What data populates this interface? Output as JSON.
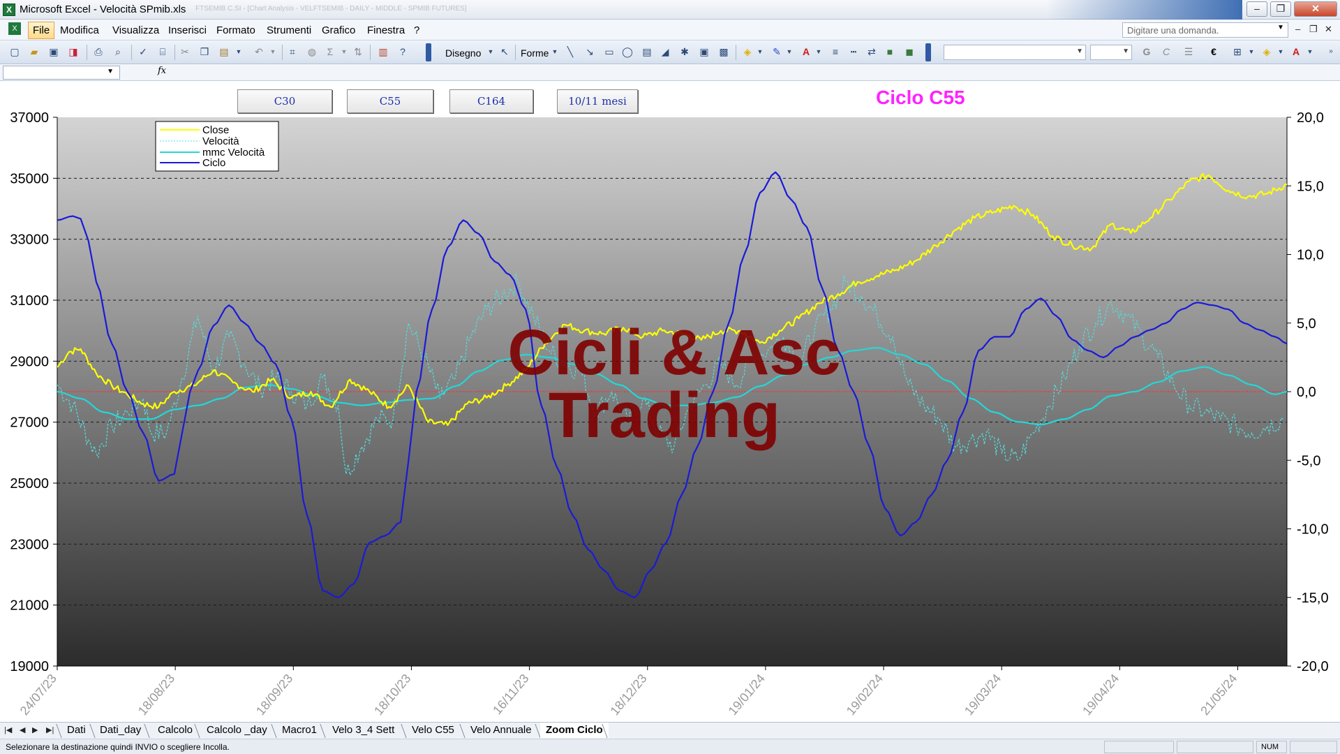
{
  "window": {
    "title": "Microsoft Excel - Velocità SPmib.xls",
    "title_blur": "FTSEMIB C.SI - [Chart Analysis - VELFTSEMIB - DAILY - MIDDLE - SPMIB FUTURES]",
    "btn_minimize": "–",
    "btn_restore": "❐",
    "btn_close": "✕"
  },
  "menu": {
    "items": [
      "File",
      "Modifica",
      "Visualizza",
      "Inserisci",
      "Formato",
      "Strumenti",
      "Grafico",
      "Finestra",
      "?"
    ],
    "ask_placeholder": "Digitare una domanda.",
    "mdi_minimize": "–",
    "mdi_restore": "❐",
    "mdi_close": "✕"
  },
  "toolbar": {
    "disegno_label": "Disegno",
    "forme_label": "Forme",
    "bold_label": "G",
    "italic_label": "C",
    "euro_label": "€",
    "sigma_label": "Σ",
    "font_letter": "A"
  },
  "formula_bar": {
    "fx": "fx"
  },
  "chart_buttons": [
    "C30",
    "C55",
    "C164",
    "10/11 mesi"
  ],
  "chart_heading": "Ciclo C55",
  "watermark": [
    "Cicli & Asc",
    "Trading"
  ],
  "sheet_tabs": [
    "Dati",
    "Dati_day",
    "Calcolo",
    "Calcolo _day",
    "Macro1",
    "Velo 3_4 Sett",
    "Velo C55",
    "Velo Annuale",
    "Zoom Ciclo"
  ],
  "active_tab": "Zoom Ciclo",
  "status": {
    "message": "Selezionare la destinazione quindi INVIO o scegliere Incolla.",
    "num": "NUM"
  },
  "chart_data": {
    "type": "line",
    "legend": [
      "Close",
      "Velocità",
      "mmc Velocità",
      "Ciclo"
    ],
    "legend_placement": "top-left",
    "colors": {
      "close": "#ffff00",
      "velocita": "#55dddd",
      "mmc_velocita": "#22d8d8",
      "ciclo": "#1a1ad8",
      "zero_line": "#ff3030",
      "heading": "#ff22ff",
      "watermark": "#800000"
    },
    "x_ticks": [
      "24/07/23",
      "18/08/23",
      "18/09/23",
      "18/10/23",
      "16/11/23",
      "18/12/23",
      "19/01/24",
      "19/02/24",
      "19/03/24",
      "19/04/24",
      "21/05/24"
    ],
    "y_left": {
      "range": [
        19000,
        37000
      ],
      "ticks": [
        "37000",
        "35000",
        "33000",
        "31000",
        "29000",
        "27000",
        "25000",
        "23000",
        "21000",
        "19000"
      ]
    },
    "y_right": {
      "range": [
        -20,
        20
      ],
      "ticks": [
        "20,0",
        "15,0",
        "10,0",
        "5,0",
        "0,0",
        "-5,0",
        "-10,0",
        "-15,0",
        "-20,0"
      ]
    },
    "grid": "horizontal dashed",
    "background": "vertical gradient light gray to dark gray",
    "series": [
      {
        "name": "Close",
        "axis": "left",
        "x": [
          0,
          3,
          6,
          10,
          14,
          18,
          22,
          26,
          30,
          35,
          40,
          45,
          50,
          55,
          60,
          65,
          70,
          75,
          80,
          85,
          90,
          95,
          100,
          105,
          110,
          115,
          120,
          125,
          130,
          135,
          140,
          145,
          150,
          155,
          160,
          165,
          170,
          175,
          180,
          185,
          190,
          195,
          200,
          205,
          210,
          215,
          220,
          225,
          230,
          235,
          240,
          245,
          250,
          255,
          260,
          265,
          270,
          275,
          280,
          285,
          290,
          295,
          300,
          305,
          310,
          315
        ],
        "y": [
          28800,
          29300,
          29400,
          28600,
          28200,
          27900,
          27600,
          27500,
          28000,
          28200,
          28700,
          28300,
          28000,
          28400,
          27800,
          28000,
          27500,
          28400,
          28000,
          27500,
          28200,
          27000,
          26900,
          27600,
          27800,
          28200,
          28700,
          29600,
          30200,
          30000,
          29900,
          30100,
          29800,
          30000,
          29900,
          29700,
          30000,
          30000,
          29600,
          30000,
          30400,
          30900,
          31200,
          31600,
          31800,
          32000,
          32300,
          32800,
          33300,
          33700,
          33900,
          34100,
          33800,
          33100,
          32800,
          32700,
          33500,
          33200,
          33700,
          34300,
          34900,
          35100,
          34600,
          34400,
          34500,
          34800
        ]
      },
      {
        "name": "Velocità",
        "axis": "right",
        "x": [
          0,
          4,
          8,
          10,
          14,
          18,
          22,
          24,
          28,
          32,
          36,
          40,
          44,
          48,
          52,
          56,
          60,
          64,
          68,
          72,
          74,
          78,
          82,
          86,
          90,
          94,
          98,
          102,
          106,
          110,
          114,
          118,
          122,
          126,
          130,
          134,
          138,
          142,
          146,
          150,
          154,
          158,
          162,
          166,
          170,
          174,
          178,
          182,
          186,
          190,
          194,
          198,
          202,
          206,
          210,
          214,
          218,
          222,
          226,
          230,
          234,
          238,
          242,
          246,
          250,
          254,
          258,
          262,
          266,
          270,
          274,
          278,
          282,
          286,
          290,
          294,
          298,
          302,
          306,
          310,
          314
        ],
        "y": [
          0.5,
          -1.0,
          -3.5,
          -4.5,
          -2.5,
          -1.5,
          -0.5,
          -3.0,
          -3.0,
          1.0,
          5.5,
          1.5,
          4.0,
          2.0,
          0.2,
          1.0,
          0.0,
          -1.0,
          1.0,
          -1.0,
          -6.0,
          -4.0,
          -2.0,
          -2.0,
          5.0,
          2.5,
          -0.5,
          1.0,
          4.0,
          6.0,
          7.0,
          8.0,
          5.5,
          3.0,
          2.0,
          1.5,
          -1.5,
          0.0,
          -2.0,
          -0.5,
          -3.0,
          -4.0,
          -1.0,
          0.5,
          2.0,
          0.5,
          2.5,
          3.0,
          4.0,
          2.0,
          4.5,
          6.0,
          8.0,
          7.0,
          5.5,
          4.0,
          0.5,
          -1.0,
          -2.0,
          -4.0,
          -3.5,
          -3.0,
          -4.5,
          -5.0,
          -3.0,
          -1.0,
          1.0,
          3.5,
          5.0,
          6.5,
          5.5,
          4.0,
          2.5,
          0.5,
          -1.0,
          -1.5,
          -2.0,
          -2.5,
          -3.0,
          -2.5,
          -2.0
        ]
      },
      {
        "name": "mmc Velocità",
        "axis": "right",
        "x": [
          0,
          6,
          12,
          18,
          24,
          30,
          36,
          42,
          48,
          54,
          60,
          66,
          72,
          78,
          84,
          90,
          96,
          102,
          108,
          114,
          120,
          126,
          132,
          138,
          144,
          150,
          156,
          162,
          168,
          174,
          180,
          186,
          192,
          198,
          204,
          210,
          216,
          222,
          228,
          234,
          240,
          246,
          252,
          258,
          264,
          270,
          276,
          282,
          288,
          294,
          300,
          306,
          312,
          315
        ],
        "y": [
          0.0,
          -0.5,
          -1.5,
          -2.0,
          -2.0,
          -1.3,
          -1.0,
          -0.5,
          0.3,
          0.5,
          0.2,
          -0.3,
          -0.8,
          -1.0,
          -0.8,
          -0.6,
          -0.5,
          0.4,
          1.5,
          2.3,
          2.7,
          2.5,
          2.0,
          1.3,
          0.5,
          -0.5,
          -1.0,
          -1.0,
          -0.8,
          -0.4,
          0.4,
          1.2,
          2.0,
          2.5,
          3.0,
          3.2,
          2.7,
          2.0,
          0.8,
          -0.5,
          -1.5,
          -2.2,
          -2.4,
          -2.0,
          -1.3,
          -0.3,
          0.0,
          0.7,
          1.5,
          1.8,
          1.2,
          0.5,
          -0.2,
          0.0
        ]
      },
      {
        "name": "Ciclo",
        "axis": "right",
        "x": [
          0,
          4,
          6,
          8,
          10,
          14,
          18,
          22,
          26,
          30,
          32,
          34,
          36,
          40,
          44,
          48,
          52,
          56,
          60,
          64,
          68,
          72,
          76,
          80,
          84,
          88,
          90,
          92,
          96,
          100,
          104,
          108,
          112,
          116,
          120,
          124,
          128,
          132,
          136,
          140,
          144,
          148,
          152,
          156,
          160,
          164,
          168,
          172,
          176,
          180,
          184,
          188,
          192,
          196,
          200,
          204,
          208,
          212,
          216,
          220,
          224,
          228,
          232,
          236,
          240,
          244,
          248,
          252,
          256,
          260,
          264,
          268,
          272,
          276,
          280,
          284,
          288,
          292,
          296,
          300,
          304,
          308,
          312,
          315
        ],
        "y": [
          12.5,
          12.8,
          12.6,
          11.0,
          8.0,
          3.5,
          0.0,
          -3.0,
          -6.5,
          -6.0,
          -3.0,
          0.0,
          1.5,
          4.8,
          6.3,
          5.0,
          3.5,
          2.0,
          -2.0,
          -9.0,
          -14.5,
          -15.0,
          -14.0,
          -11.0,
          -10.5,
          -9.5,
          -5.0,
          0.0,
          6.0,
          10.5,
          12.5,
          11.5,
          9.5,
          8.5,
          6.0,
          -1.0,
          -5.5,
          -9.0,
          -11.5,
          -13.0,
          -14.5,
          -15.0,
          -13.0,
          -11.0,
          -7.5,
          -4.0,
          0.0,
          5.0,
          10.0,
          14.5,
          16.0,
          14.0,
          12.0,
          7.5,
          3.0,
          0.0,
          -4.0,
          -8.5,
          -10.5,
          -9.5,
          -7.5,
          -5.0,
          -1.5,
          3.0,
          4.0,
          4.0,
          6.0,
          6.8,
          5.5,
          3.8,
          3.0,
          2.5,
          3.3,
          4.0,
          4.5,
          5.0,
          6.0,
          6.5,
          6.3,
          6.0,
          5.0,
          4.5,
          4.0,
          3.5
        ]
      }
    ]
  }
}
